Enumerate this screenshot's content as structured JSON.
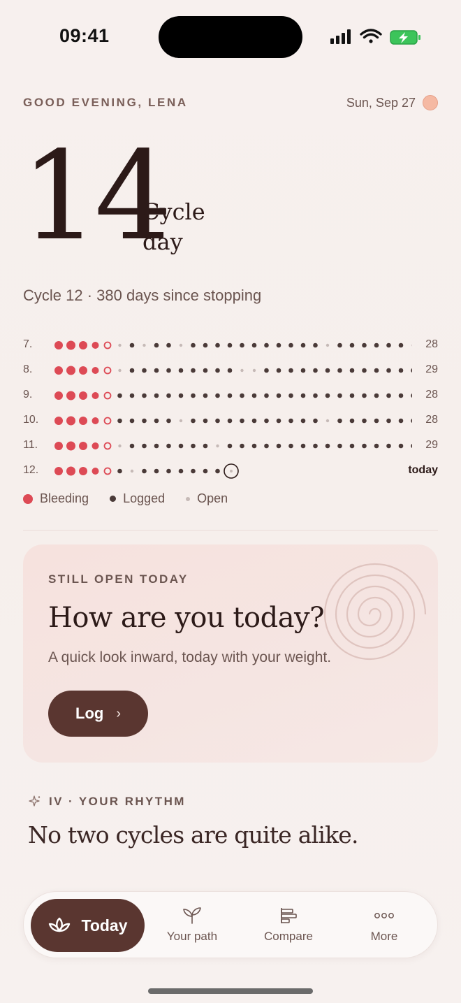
{
  "status_bar": {
    "time": "09:41"
  },
  "header": {
    "greeting": "GOOD EVENING, LENA",
    "date": "Sun, Sep 27"
  },
  "hero": {
    "cycle_day": "14",
    "label": "Cycle day",
    "summary": "Cycle 12 · 380 days since stopping"
  },
  "cycles": [
    {
      "label": "7.",
      "length": "28",
      "pattern": "BBBBOSLSLLSLLLLLLLLLLLSLLLLLLSL"
    },
    {
      "label": "8.",
      "length": "29",
      "pattern": "BBBBOSLLLLLLLLLSSLLLLLLLLLLLLLL"
    },
    {
      "label": "9.",
      "length": "28",
      "pattern": "BBBBOLLLLLLLLLLLLLLLLLLLLLLLLLL"
    },
    {
      "label": "10.",
      "length": "28",
      "pattern": "BBBBOLLLLLSLLLLLLLLLLLSLLLLLLLS"
    },
    {
      "label": "11.",
      "length": "29",
      "pattern": "BBBBOSLLLLLLLSLLLLLLLLLLLLLLLLS"
    },
    {
      "label": "12.",
      "length": "today",
      "pattern": "BBBBOLSLLLLLLLT"
    }
  ],
  "legend": {
    "bleeding": "Bleeding",
    "logged": "Logged",
    "open": "Open"
  },
  "colors": {
    "bleeding": "#dd4a55",
    "logged": "#4a3a38",
    "open": "#c6bab7",
    "accent": "#5a3630"
  },
  "card": {
    "kicker": "STILL OPEN TODAY",
    "title": "How are you today?",
    "subtitle": "A quick look inward, today with your weight.",
    "button": "Log"
  },
  "rhythm": {
    "kicker": "IV · YOUR RHYTHM",
    "title": "No two cycles are quite alike."
  },
  "tabs": [
    {
      "label": "Today",
      "icon": "lotus-icon"
    },
    {
      "label": "Your path",
      "icon": "sprout-icon"
    },
    {
      "label": "Compare",
      "icon": "bars-icon"
    },
    {
      "label": "More",
      "icon": "more-dots-icon"
    }
  ]
}
